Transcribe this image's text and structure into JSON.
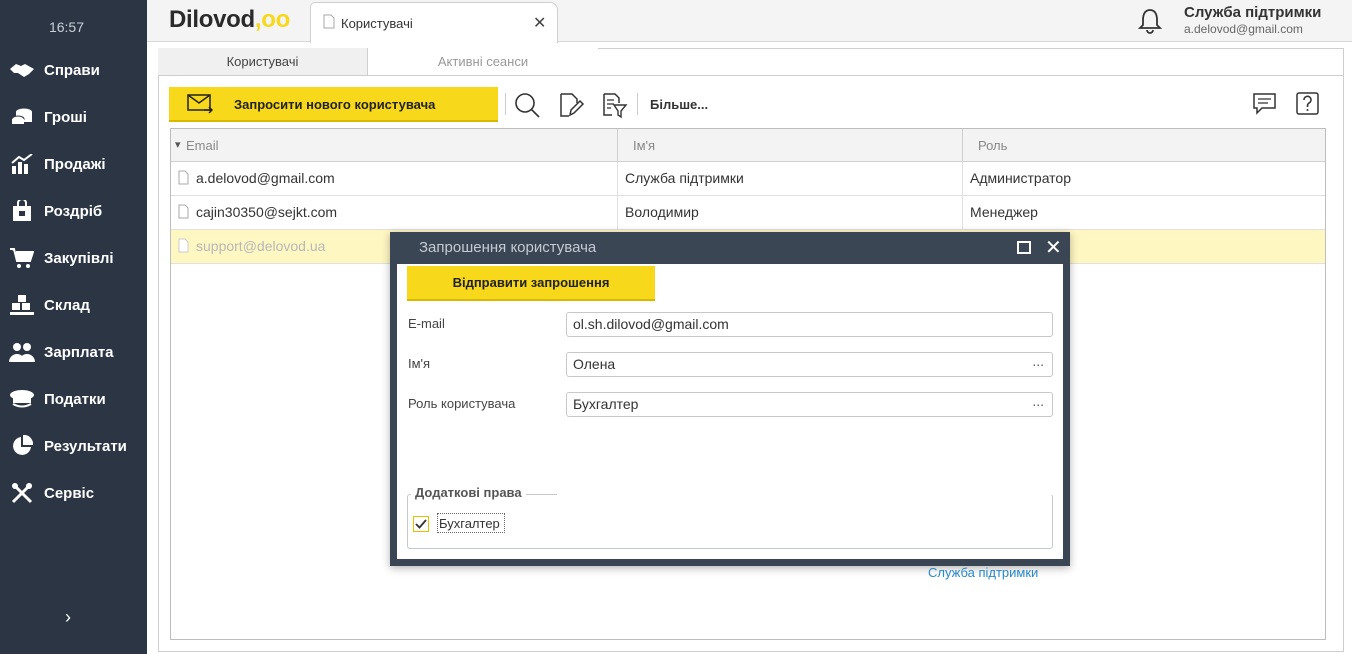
{
  "sidebar": {
    "time": "16:57",
    "items": [
      {
        "label": "Справи",
        "icon": "handshake-icon"
      },
      {
        "label": "Гроші",
        "icon": "coins-icon"
      },
      {
        "label": "Продажі",
        "icon": "chart-icon"
      },
      {
        "label": "Роздріб",
        "icon": "shopping-bag-icon"
      },
      {
        "label": "Закупівлі",
        "icon": "cart-icon"
      },
      {
        "label": "Склад",
        "icon": "boxes-icon"
      },
      {
        "label": "Зарплата",
        "icon": "people-icon"
      },
      {
        "label": "Податки",
        "icon": "officer-cap-icon"
      },
      {
        "label": "Результати",
        "icon": "pie-chart-icon"
      },
      {
        "label": "Сервіс",
        "icon": "tools-icon"
      }
    ],
    "expand_glyph": "›"
  },
  "topbar": {
    "logo_text": "Dilovod",
    "logo_suffix": ",oo",
    "tab_label": "Користувачі",
    "tab_close": "✕",
    "user_name": "Служба підтримки",
    "user_email": "a.delovod@gmail.com"
  },
  "subtabs": {
    "active": "Користувачі",
    "inactive": "Активні сеанси"
  },
  "toolbar": {
    "invite_label": "Запросити нового користувача",
    "more_label": "Більше..."
  },
  "table": {
    "sort_glyph": "▾",
    "columns": [
      "Email",
      "Ім'я",
      "Роль"
    ],
    "rows": [
      {
        "email": "a.delovod@gmail.com",
        "name": "Служба підтримки",
        "role": "Администратор"
      },
      {
        "email": "cajin30350@sejkt.com",
        "name": "Володимир",
        "role": "Менеджер"
      },
      {
        "email": "support@delovod.ua",
        "name": "",
        "role": ""
      }
    ]
  },
  "modal": {
    "title": "Запрошення користувача",
    "send_label": "Відправити запрошення",
    "email_label": "E-mail",
    "email_value": "ol.sh.dilovod@gmail.com",
    "name_label": "Ім'я",
    "name_value": "Олена",
    "role_label": "Роль користувача",
    "role_value": "Бухгалтер",
    "picker_glyph": "...",
    "close_glyph": "✕",
    "extra_rights_title": "Додаткові права",
    "extra_right_label": "Бухгалтер",
    "extra_right_checked": true,
    "support_link": "Служба підтримки"
  },
  "colors": {
    "sidebar_bg": "#2b3544",
    "accent_yellow": "#f7d81a",
    "selected_row": "#fff7c2",
    "modal_frame": "#3b4654",
    "link": "#2a8ac6"
  }
}
